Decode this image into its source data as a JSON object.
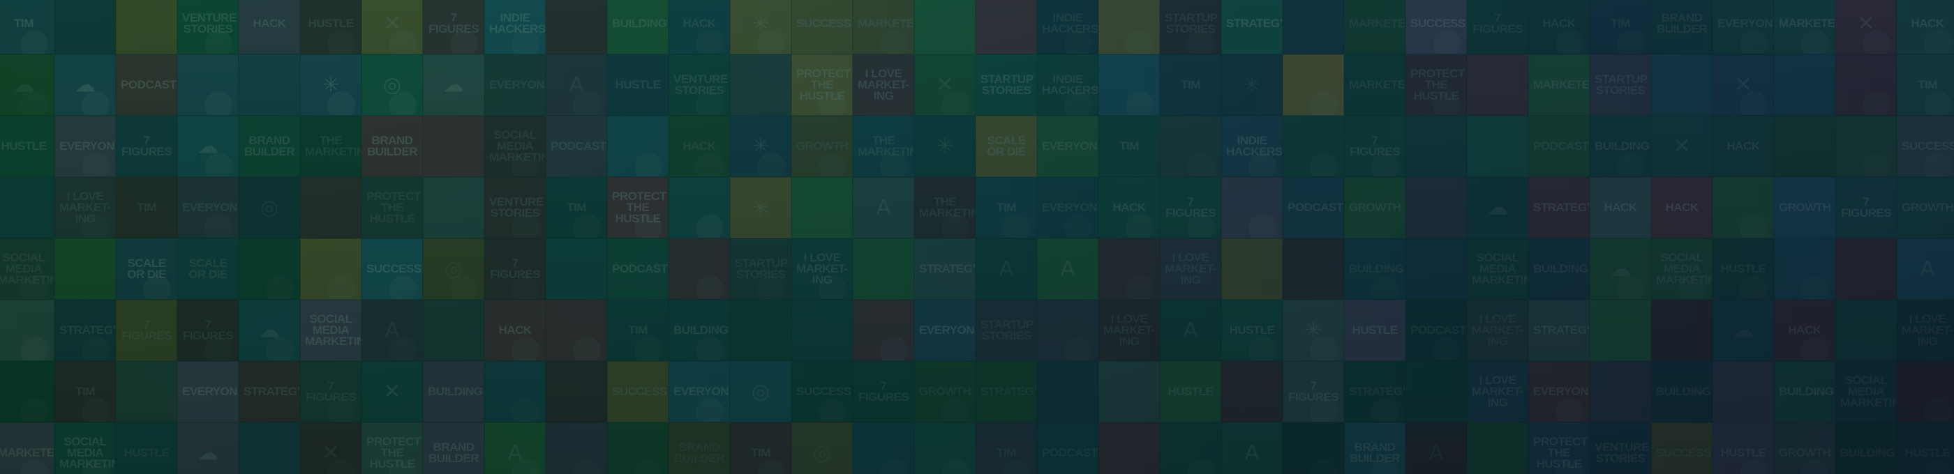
{
  "background": {
    "kind": "podcast-cover-mosaic",
    "palette": [
      "#1e6b4f",
      "#2a6f8f",
      "#3c8c3a",
      "#c08a2a",
      "#2f4f7a",
      "#7a4a7a",
      "#5a6a6a",
      "#1f5f5f",
      "#8a2a3a"
    ],
    "overlay_colors": [
      "#064630",
      "#083e3e",
      "#0e2a3c"
    ],
    "tile_captions": [
      "BRAND BUILDER",
      "HACK",
      "GROWTH",
      "I LOVE MARKET-ING",
      "TIM",
      "SCALE OR DIE",
      "PROTECT THE HUSTLE",
      "INDIE HACKERS",
      "THE MARKETING",
      "EVERYONE",
      "7 FIGURES",
      "STARTUP STORIES",
      "Social Media Marketing",
      "Venture Stories",
      "MARKETERS",
      "BUILDING",
      "SUCCESS",
      "Strategy",
      "Podcast",
      "Hustle"
    ],
    "tile_icons": [
      "A",
      "✕",
      "☁",
      "◎",
      "✳"
    ]
  }
}
